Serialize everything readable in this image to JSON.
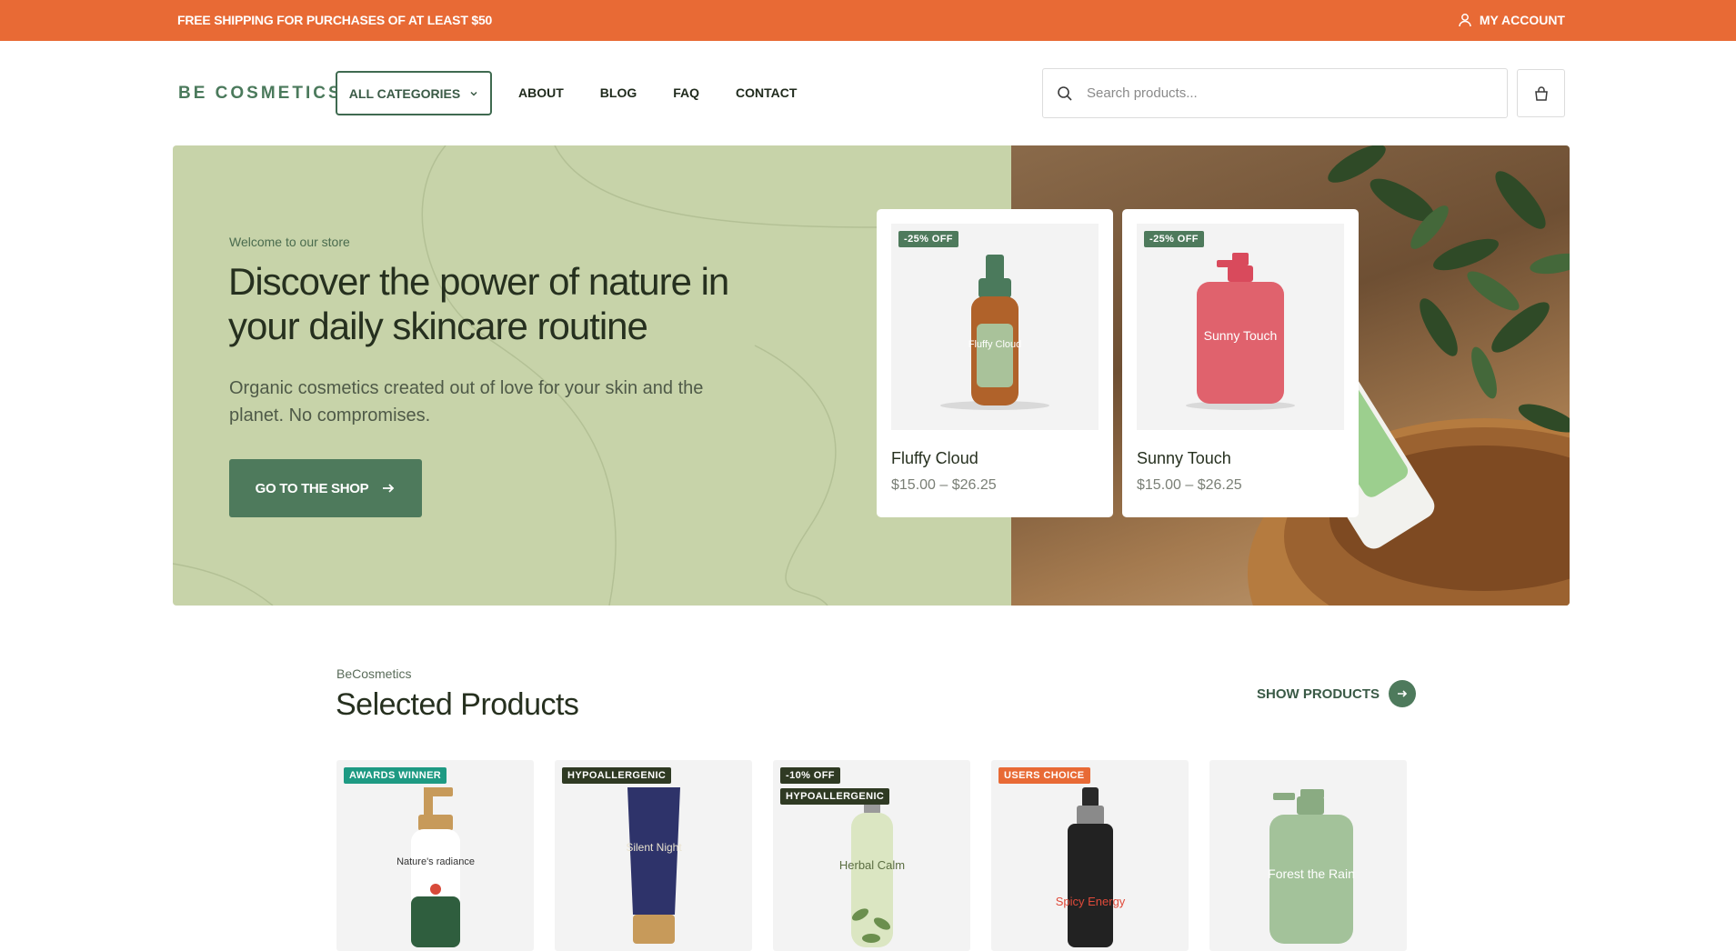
{
  "topbar": {
    "promo": "FREE SHIPPING FOR PURCHASES OF AT LEAST $50",
    "account": "MY ACCOUNT"
  },
  "header": {
    "logo": "BE COSMETICS",
    "categories_label": "ALL CATEGORIES",
    "nav": [
      "ABOUT",
      "BLOG",
      "FAQ",
      "CONTACT"
    ],
    "search_placeholder": "Search products..."
  },
  "hero": {
    "eyebrow": "Welcome to our store",
    "title": "Discover the power of nature in your daily skincare routine",
    "subtitle": "Organic cosmetics created out of love for your skin and the planet. No compromises.",
    "cta": "GO TO THE SHOP",
    "products": [
      {
        "name": "Fluffy Cloud",
        "price": "$15.00 – $26.25",
        "badge": "-25% OFF",
        "label": "Fluffy Cloud"
      },
      {
        "name": "Sunny Touch",
        "price": "$15.00 – $26.25",
        "badge": "-25% OFF",
        "label": "Sunny Touch"
      }
    ]
  },
  "selected": {
    "eyebrow": "BeCosmetics",
    "title": "Selected Products",
    "show_link": "SHOW PRODUCTS",
    "products": [
      {
        "badges": [
          "AWARDS WINNER"
        ],
        "label": "Nature's radiance"
      },
      {
        "badges": [
          "HYPOALLERGENIC"
        ],
        "label": "Silent Night"
      },
      {
        "badges": [
          "-10% OFF",
          "HYPOALLERGENIC"
        ],
        "label": "Herbal Calm"
      },
      {
        "badges": [
          "USERS CHOICE"
        ],
        "label": "Spicy Energy"
      },
      {
        "badges": [],
        "label": "Forest the Rain"
      }
    ]
  },
  "colors": {
    "orange": "#e86a35",
    "green": "#4e7a5c",
    "sage": "#c7d3a9",
    "dark_badge": "#2f3a23",
    "teal_badge": "#1e9a83"
  }
}
